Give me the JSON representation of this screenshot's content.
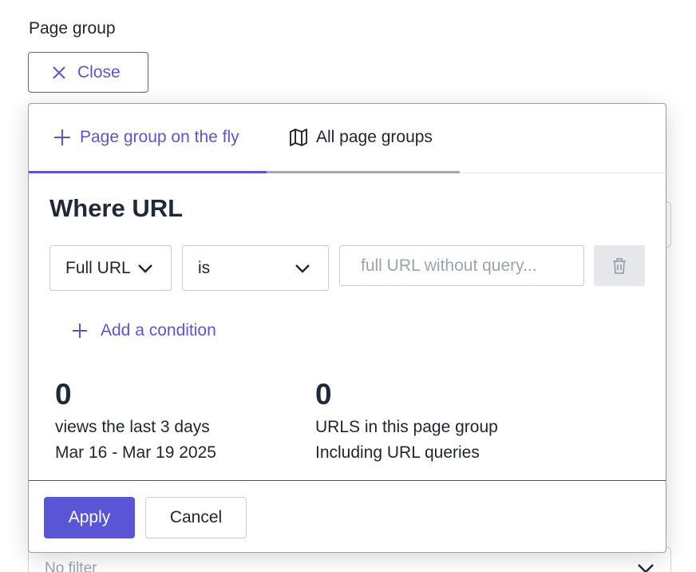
{
  "page": {
    "label": "Page group"
  },
  "close_button": {
    "label": "Close"
  },
  "popover": {
    "tabs": [
      {
        "label": "Page group on the fly",
        "icon": "plus-icon",
        "active": true
      },
      {
        "label": "All page groups",
        "icon": "map-icon",
        "active": false
      }
    ],
    "heading": "Where URL",
    "condition": {
      "field": "Full URL",
      "operator": "is",
      "value": "",
      "placeholder": "full URL without query..."
    },
    "add_condition_label": "Add a condition",
    "stats": {
      "views": {
        "value": "0",
        "label": "views the last 3 days",
        "range": "Mar 16 - Mar 19 2025"
      },
      "urls": {
        "value": "0",
        "label": "URLS in this page group",
        "note": "Including URL queries"
      }
    },
    "apply_label": "Apply",
    "cancel_label": "Cancel"
  },
  "background": {
    "filter_placeholder": "No filter"
  },
  "colors": {
    "accent": "#5a55d6",
    "text": "#1f2530",
    "muted": "#9ca3af"
  }
}
